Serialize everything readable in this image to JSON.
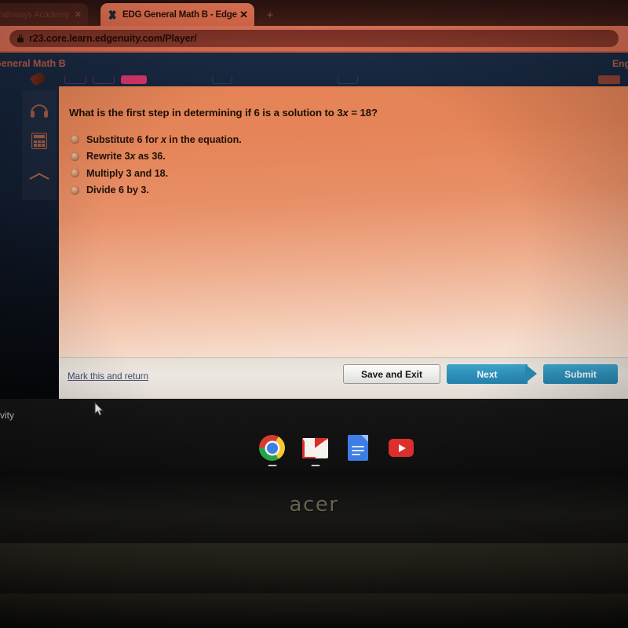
{
  "browser": {
    "tabs": [
      {
        "title": "Pathways Academy W",
        "active": false,
        "close_label": "✕"
      },
      {
        "title": "EDG General Math B - Edgenuity",
        "active": true,
        "close_label": "✕"
      }
    ],
    "new_tab_label": "+",
    "url": "r23.core.learn.edgenuity.com/Player/",
    "lock_icon": "lock-icon",
    "favicon": "edgenuity-x-favicon"
  },
  "app_header": {
    "course_title": "General Math B",
    "language_label": "Engl",
    "accent_color": "#c95c3e",
    "background_color": "#16253c"
  },
  "tool_rail": {
    "icons": [
      {
        "name": "pen-highlighter-icon"
      },
      {
        "name": "headphones-icon"
      },
      {
        "name": "calculator-icon"
      },
      {
        "name": "chevron-up-icon"
      }
    ]
  },
  "question": {
    "prompt_prefix": "What is the first step in determining if 6 is a solution to ",
    "equation_coefficient": "3",
    "equation_variable": "x",
    "equation_rest": " = 18?",
    "choices": [
      {
        "id": "a",
        "text": "Substitute 6 for x in the equation.",
        "selected": false
      },
      {
        "id": "b",
        "text": "Rewrite 3x as 36.",
        "selected": false
      },
      {
        "id": "c",
        "text": "Multiply 3 and 18.",
        "selected": false
      },
      {
        "id": "d",
        "text": "Divide 6 by 3.",
        "selected": false
      }
    ]
  },
  "footer": {
    "mark_link": "Mark this and return",
    "save_exit_label": "Save and Exit",
    "next_label": "Next",
    "submit_label": "Submit",
    "button_color": "#2d8fb8"
  },
  "desktop": {
    "activity_text": "tivity",
    "shelf": [
      {
        "name": "chrome-icon",
        "label": "Chrome",
        "running": true
      },
      {
        "name": "gmail-icon",
        "label": "Gmail",
        "running": true
      },
      {
        "name": "google-docs-icon",
        "label": "Docs",
        "running": false
      },
      {
        "name": "youtube-icon",
        "label": "YouTube",
        "running": false
      }
    ]
  },
  "hardware": {
    "brand_logo": "acer"
  }
}
